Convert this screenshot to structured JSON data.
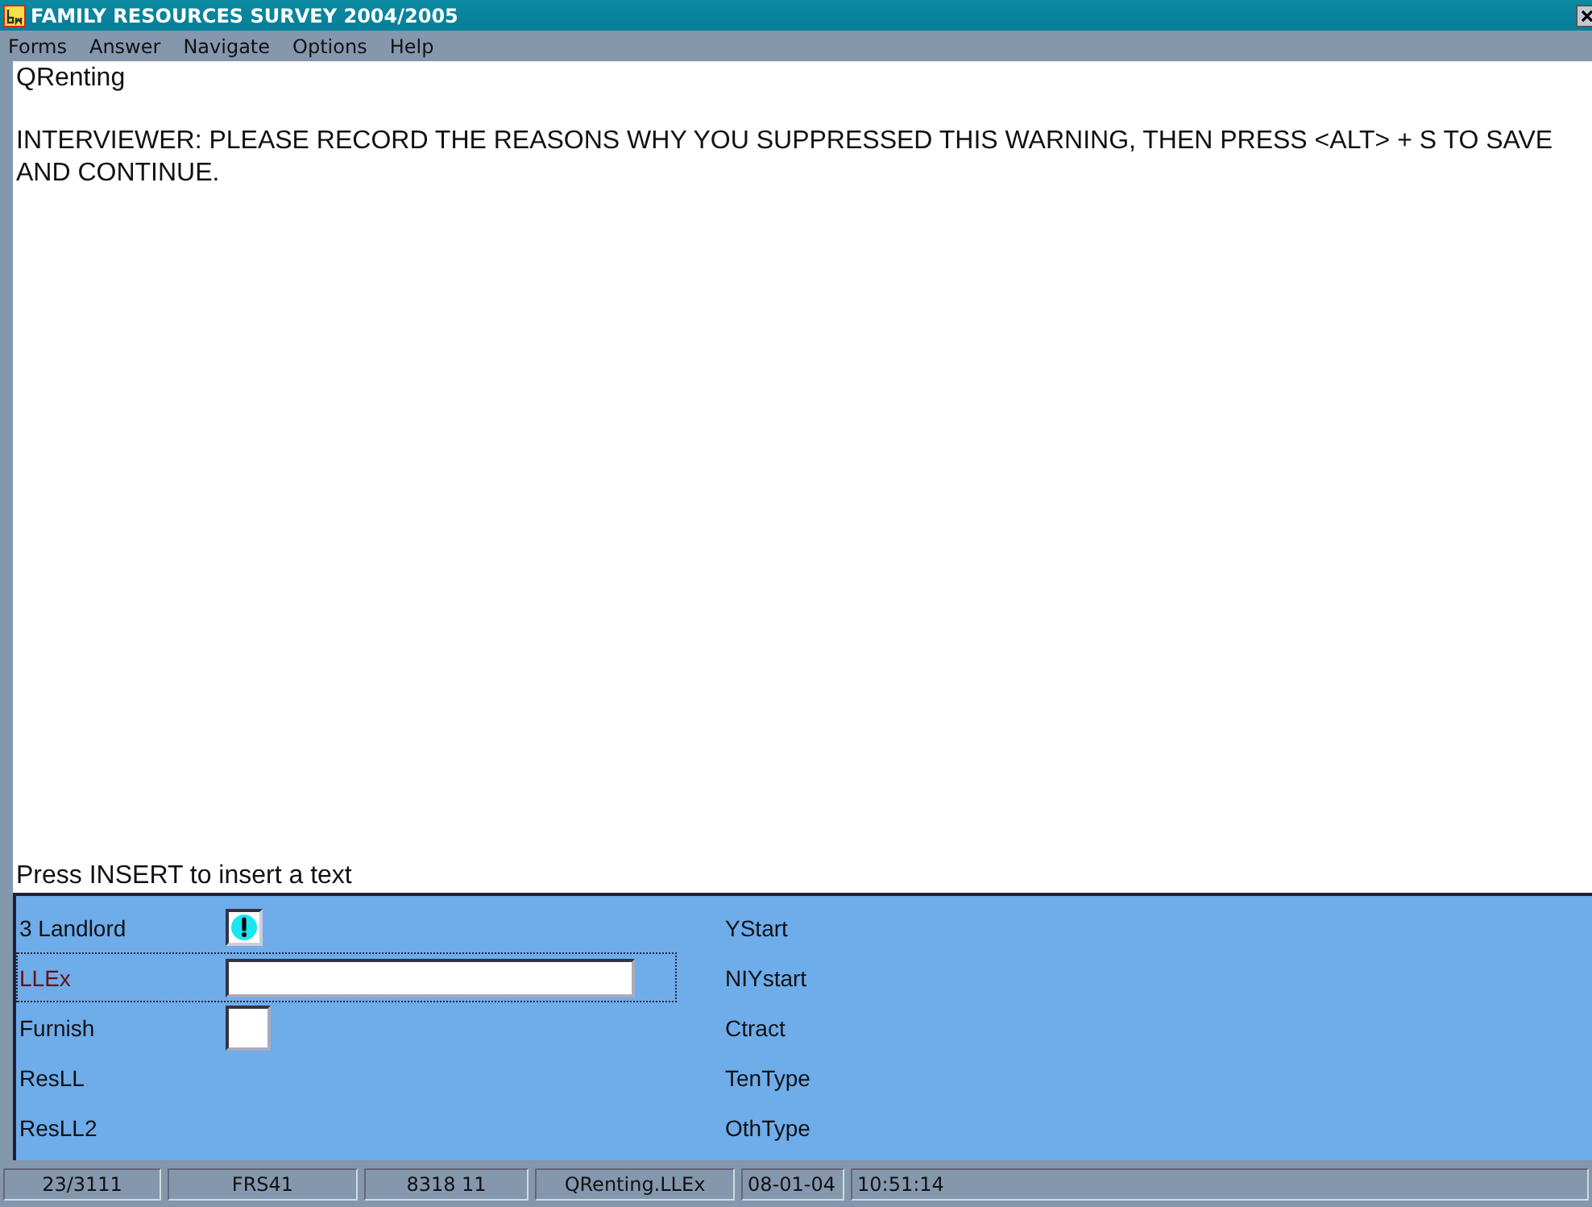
{
  "window": {
    "title": "FAMILY RESOURCES SURVEY 2004/2005"
  },
  "menu": [
    "Forms",
    "Answer",
    "Navigate",
    "Options",
    "Help"
  ],
  "question": {
    "name": "QRenting",
    "text": "INTERVIEWER: PLEASE RECORD THE REASONS WHY YOU SUPPRESSED THIS WARNING, THEN PRESS <ALT> + S TO SAVE AND CONTINUE.",
    "hint": "Press INSERT to insert a text"
  },
  "fields": [
    {
      "label": "3 Landlord",
      "kind": "warning",
      "selected": false
    },
    {
      "label": "LLEx",
      "kind": "text",
      "selected": true
    },
    {
      "label": "Furnish",
      "kind": "box",
      "selected": false
    },
    {
      "label": "ResLL",
      "kind": "none",
      "selected": false
    },
    {
      "label": "ResLL2",
      "kind": "none",
      "selected": false
    }
  ],
  "right_fields": [
    "YStart",
    "NIYstart",
    "Ctract",
    "TenType",
    "OthType"
  ],
  "status_bar": [
    "23/3111",
    "FRS41",
    "8318 11",
    "QRenting.LLEx",
    "08-01-04",
    "10:51:14"
  ]
}
